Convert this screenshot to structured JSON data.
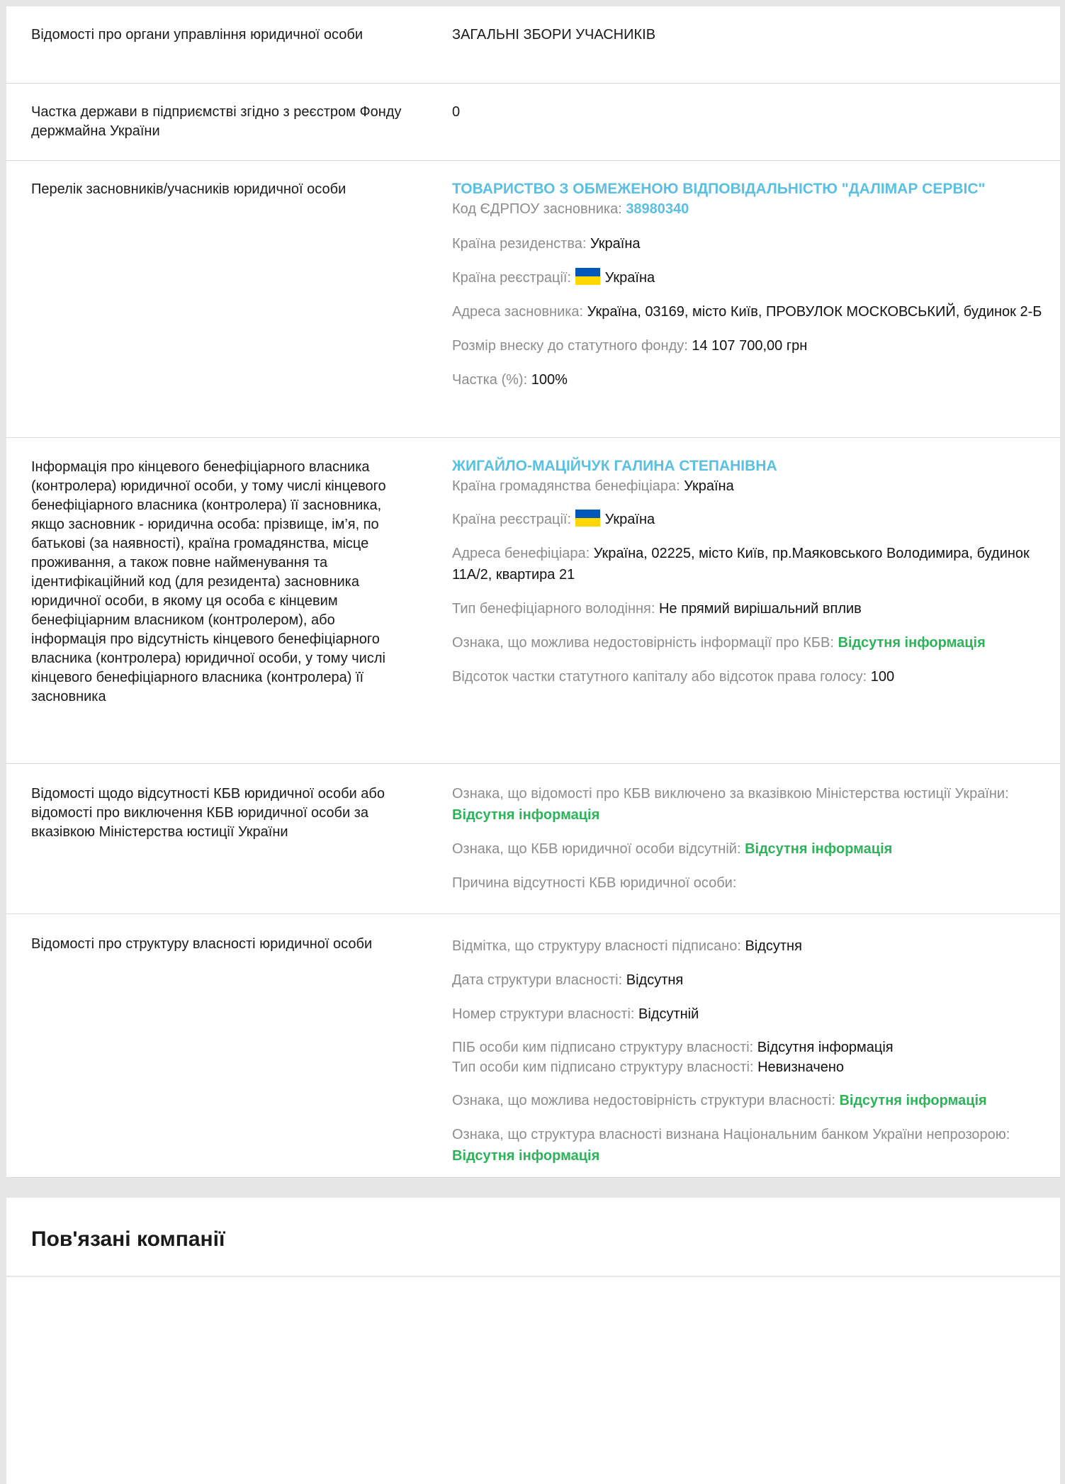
{
  "rows": {
    "management": {
      "label": "Відомості про органи управління юридичної особи",
      "value": "ЗАГАЛЬНІ ЗБОРИ УЧАСНИКІВ"
    },
    "state_share": {
      "label": "Частка держави в підприємстві згідно з реєстром Фонду держмайна України",
      "value": "0"
    },
    "founders": {
      "label": "Перелік засновників/учасників юридичної особи",
      "name": "ТОВАРИСТВО З ОБМЕЖЕНОЮ ВІДПОВІДАЛЬНІСТЮ \"ДАЛІМАР СЕРВІС\"",
      "code_label": "Код ЄДРПОУ засновника:",
      "code_value": "38980340",
      "residence_label": "Країна резиденства:",
      "residence_value": "Україна",
      "registration_label": "Країна реєстрації:",
      "registration_value": "Україна",
      "address_label": "Адреса засновника:",
      "address_value": "Україна, 03169, місто Київ, ПРОВУЛОК МОСКОВСЬКИЙ, будинок 2-Б",
      "contribution_label": "Розмір внеску до статутного фонду:",
      "contribution_value": "14 107 700,00 грн",
      "share_label": "Частка (%):",
      "share_value": "100%"
    },
    "beneficiary": {
      "label": "Інформація про кінцевого бенефіціарного власника (контролера) юридичної особи, у тому числі кінцевого бенефіціарного власника (контролера) її засновника, якщо засновник - юридична особа: прізвище, ім’я, по батькові (за наявності), країна громадянства, місце проживання, а також повне найменування та ідентифікаційний код (для резидента) засновника юридичної особи, в якому ця особа є кінцевим бенефіціарним власником (контролером), або інформація про відсутність кінцевого бенефіціарного власника (контролера) юридичної особи, у тому числі кінцевого бенефіціарного власника (контролера) її засновника",
      "name": "ЖИГАЙЛО-МАЦІЙЧУК ГАЛИНА СТЕПАНІВНА",
      "citizenship_label": "Країна громадянства бенефіціара:",
      "citizenship_value": "Україна",
      "registration_label": "Країна реєстрації:",
      "registration_value": "Україна",
      "address_label": "Адреса бенефіціара:",
      "address_value": "Україна, 02225, місто Київ, пр.Маяковського Володимира, будинок 11А/2, квартира 21",
      "ownership_label": "Тип бенефіціарного володіння:",
      "ownership_value": "Не прямий вирішальний вплив",
      "unreliable_label": "Ознака, що можлива недостовірність інформації про КБВ:",
      "unreliable_value": "Відсутня інформація",
      "percent_label": "Відсоток частки статутного капіталу або відсоток права голосу:",
      "percent_value": "100"
    },
    "kbv_absence": {
      "label": "Відомості щодо відсутності КБВ юридичної особи або відомості про виключення КБВ юридичної особи за вказівкою Міністерства юстиції України",
      "excluded_label": "Ознака, що відомості про КБВ виключено за вказівкою Міністерства юстиції України:",
      "excluded_value": "Відсутня інформація",
      "absent_label": "Ознака, що КБВ юридичної особи відсутній:",
      "absent_value": "Відсутня інформація",
      "reason_label": "Причина відсутності КБВ юридичної особи:"
    },
    "structure": {
      "label": "Відомості про структуру власності юридичної особи",
      "signed_label": "Відмітка, що структуру власності підписано:",
      "signed_value": "Відсутня",
      "date_label": "Дата структури власності:",
      "date_value": "Відсутня",
      "number_label": "Номер структури власності:",
      "number_value": "Відсутній",
      "signer_label": "ПІБ особи ким підписано структуру власності:",
      "signer_value": "Відсутня інформація",
      "signer_type_label": "Тип особи ким підписано структуру власності:",
      "signer_type_value": "Невизначено",
      "unreliable_label": "Ознака, що можлива недостовірність структури власності:",
      "unreliable_value": "Відсутня інформація",
      "opaque_label": "Ознака, що структура власності визнана Національним банком України непрозорою:",
      "opaque_value": "Відсутня інформація"
    }
  },
  "related": {
    "title": "Пов'язані компанії"
  },
  "colors": {
    "link": "#5bbfe0",
    "green": "#2fb35a",
    "muted_label": "#8c8c8c",
    "divider": "#d9d9d9",
    "flag_blue": "#0057b7",
    "flag_yellow": "#ffd700"
  },
  "icons": [
    "ukraine-flag-icon"
  ]
}
